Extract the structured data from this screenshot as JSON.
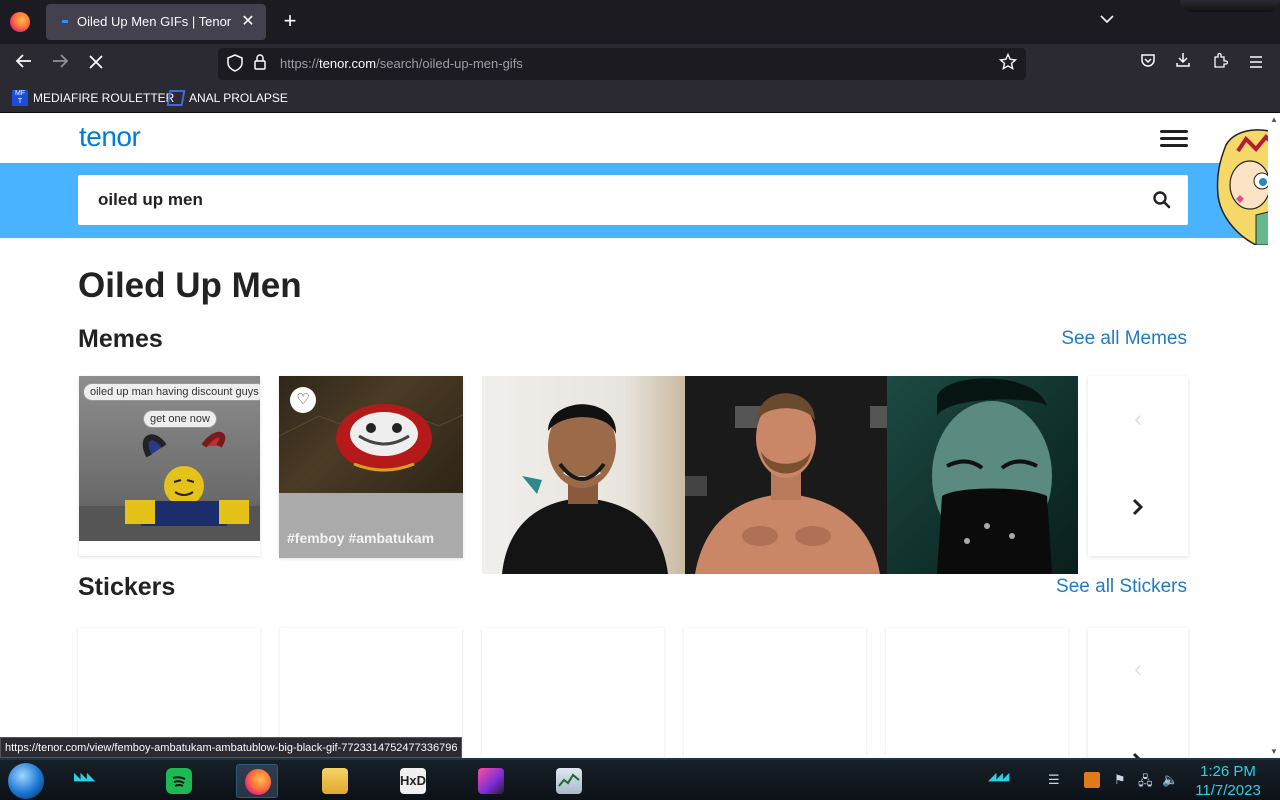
{
  "browser": {
    "tab_title": "Oiled Up Men GIFs | Tenor",
    "tab_close": "✕",
    "new_tab": "+",
    "tab_list": "⌄",
    "url_prefix": "https://",
    "url_host": "tenor.com",
    "url_path": "/search/oiled-up-men-gifs",
    "bookmarks": [
      {
        "label": "MEDIAFIRE ROULETTER",
        "icon": "mediafire-icon"
      },
      {
        "label": "ANAL PROLAPSE",
        "icon": "bookmark-icon"
      }
    ],
    "status_url": "https://tenor.com/view/femboy-ambatukam-ambatublow-big-black-gif-7723314752477336796"
  },
  "page": {
    "logo": "tenor",
    "search_value": "oiled up men",
    "title": "Oiled Up Men",
    "memes": {
      "heading": "Memes",
      "see_all": "See all Memes",
      "meme_text_1": "oiled up man having discount guys",
      "meme_text_2": "get one now",
      "tags": "#femboy  #ambatukam"
    },
    "stickers": {
      "heading": "Stickers",
      "see_all": "See all Stickers"
    }
  },
  "taskbar": {
    "time": "1:26 PM",
    "date": "11/7/2023"
  },
  "colors": {
    "accent_blue": "#4ab3ff",
    "logo_blue": "#007bdb",
    "link_blue": "#1e7cc2",
    "clock_cyan": "#2ad0e6"
  }
}
